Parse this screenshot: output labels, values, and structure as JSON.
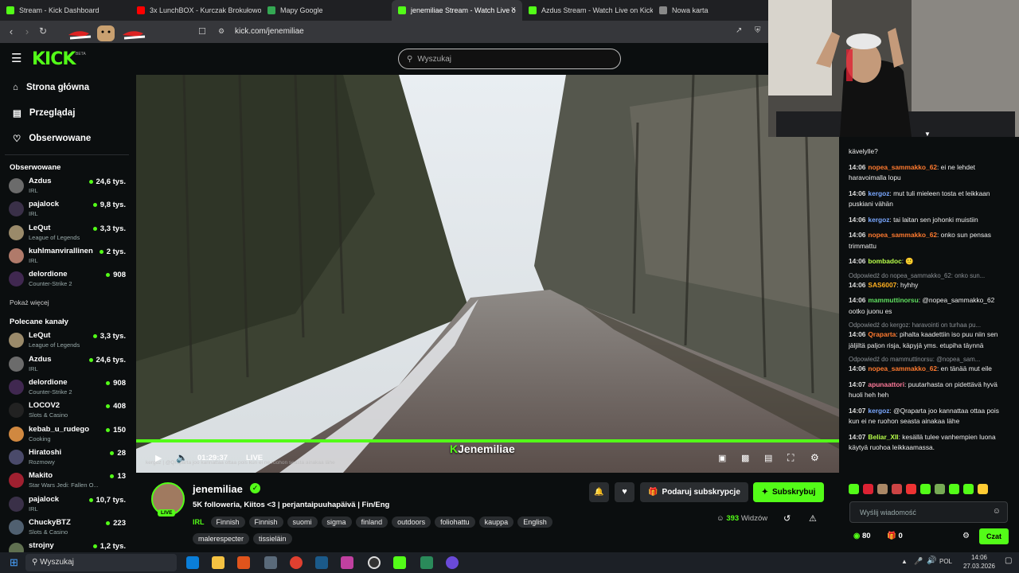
{
  "tabs": [
    {
      "title": "Stream - Kick Dashboard",
      "color": "#53fc18"
    },
    {
      "title": "3x LunchBOX - Kurczak Brokułowo S",
      "color": "#ff0000"
    },
    {
      "title": "Mapy Google",
      "color": "#34a853"
    },
    {
      "title": "jenemiliae Stream - Watch Live o",
      "color": "#53fc18"
    },
    {
      "title": "Azdus Stream - Watch Live on Kick",
      "color": "#53fc18"
    },
    {
      "title": "Nowa karta",
      "color": "#888888"
    }
  ],
  "address": {
    "url": "kick.com/jenemiliae"
  },
  "header": {
    "logo": "KICK",
    "beta": "BETA",
    "search_placeholder": "Wyszukaj"
  },
  "sidebar": {
    "nav": [
      {
        "label": "Strona główna",
        "icon": "home-icon"
      },
      {
        "label": "Przeglądaj",
        "icon": "browse-icon"
      },
      {
        "label": "Obserwowane",
        "icon": "heart-icon"
      }
    ],
    "followed_title": "Obserwowane",
    "followed": [
      {
        "name": "Azdus",
        "cat": "IRL",
        "viewers": "24,6 tys.",
        "color": "#6b6b6b"
      },
      {
        "name": "pajalock",
        "cat": "IRL",
        "viewers": "9,8 tys.",
        "color": "#3a3048"
      },
      {
        "name": "LeQut",
        "cat": "League of Legends",
        "viewers": "3,3 tys.",
        "color": "#9a8a6a"
      },
      {
        "name": "kuhlmanvirallinen",
        "cat": "IRL",
        "viewers": "2 tys.",
        "color": "#b07a6a"
      },
      {
        "name": "delordione",
        "cat": "Counter-Strike 2",
        "viewers": "908",
        "color": "#402850"
      }
    ],
    "show_more": "Pokaż więcej",
    "recommended_title": "Polecane kanały",
    "recommended": [
      {
        "name": "LeQut",
        "cat": "League of Legends",
        "viewers": "3,3 tys.",
        "color": "#9a8a6a"
      },
      {
        "name": "Azdus",
        "cat": "IRL",
        "viewers": "24,6 tys.",
        "color": "#6b6b6b"
      },
      {
        "name": "delordione",
        "cat": "Counter-Strike 2",
        "viewers": "908",
        "color": "#402850"
      },
      {
        "name": "LOCOV2",
        "cat": "Slots & Casino",
        "viewers": "408",
        "color": "#222"
      },
      {
        "name": "kebab_u_rudego",
        "cat": "Cooking",
        "viewers": "150",
        "color": "#d08840"
      },
      {
        "name": "Hiratoshi",
        "cat": "Rozmowy",
        "viewers": "28",
        "color": "#4a4a6a"
      },
      {
        "name": "Makito",
        "cat": "Star Wars Jedi: Fallen O...",
        "viewers": "13",
        "color": "#a02030"
      },
      {
        "name": "pajalock",
        "cat": "IRL",
        "viewers": "10,7 tys.",
        "color": "#3a3048"
      },
      {
        "name": "ChuckyBTZ",
        "cat": "Slots & Casino",
        "viewers": "223",
        "color": "#506070"
      },
      {
        "name": "strojny",
        "cat": "",
        "viewers": "1,2 tys.",
        "color": "#607050"
      }
    ]
  },
  "player": {
    "time": "01:29:37",
    "live": "LIVE",
    "watermark": "Jenemiliae",
    "overlay_chat": "kergoz | @Qraparta joo kannattaa ottaa pois kun ei ne ruohon seasta ainakaa lähe"
  },
  "streamer": {
    "name": "jenemiliae",
    "live_badge": "LIVE",
    "title": "5K followeria, Kiitos <3 | perjantaipuuhapäivä | Fin/Eng",
    "category": "IRL",
    "tags": [
      "Finnish",
      "Finnish",
      "suomi",
      "sigma",
      "finland",
      "outdoors",
      "foliohattu",
      "kauppa",
      "English",
      "malerespecter",
      "tissieläin"
    ],
    "gift_label": "Podaruj subskrypcje",
    "sub_label": "Subskrybuj",
    "viewers": "393",
    "viewers_label": "Widzów"
  },
  "chat": {
    "top_fragment": "kävelylle?",
    "messages": [
      {
        "ts": "14:06",
        "user": "nopea_sammakko_62",
        "color": "#ff7a2f",
        "text": "ei ne lehdet haravoimalla lopu"
      },
      {
        "ts": "14:06",
        "user": "kergoz",
        "color": "#7aa8ff",
        "text": "mut tuli mieleen tosta et leikkaan puskiani vähän"
      },
      {
        "ts": "14:06",
        "user": "kergoz",
        "color": "#7aa8ff",
        "text": "tai laitan sen johonki muistiin"
      },
      {
        "ts": "14:06",
        "user": "nopea_sammakko_62",
        "color": "#ff7a2f",
        "text": "onko sun pensas trimmattu"
      },
      {
        "ts": "14:06",
        "user": "bombadoc",
        "color": "#b8ff4a",
        "text": "🙂"
      },
      {
        "reply": "Odpowiedź do nopea_sammakko_62: onko sun..."
      },
      {
        "ts": "14:06",
        "user": "SAS6007",
        "color": "#ffb020",
        "text": "hyhhy"
      },
      {
        "ts": "14:06",
        "user": "mammuttinorsu",
        "color": "#60e060",
        "text": "@nopea_sammakko_62 ootko juonu es"
      },
      {
        "reply": "Odpowiedź do kergoz: haravointi on turhaa pu..."
      },
      {
        "ts": "14:06",
        "user": "Qraparta",
        "color": "#ff7a2f",
        "text": "pihalta kaadettiin iso puu niin sen jäljiltä paljon risja, käpyjä yms. etupiha täynnä"
      },
      {
        "reply": "Odpowiedź do mammuttinorsu: @nopea_sam..."
      },
      {
        "ts": "14:06",
        "user": "nopea_sammakko_62",
        "color": "#ff7a2f",
        "text": "en tänää mut eile"
      },
      {
        "ts": "14:07",
        "user": "apunaattori",
        "color": "#ff7a9a",
        "text": "puutarhasta on pidettävä hyvä huoli heh heh"
      },
      {
        "ts": "14:07",
        "user": "kergoz",
        "color": "#7aa8ff",
        "text": "@Qraparta joo kannattaa ottaa pois kun ei ne ruohon seasta ainakaa lähe"
      },
      {
        "ts": "14:07",
        "user": "Beliar_XII",
        "color": "#b8ff4a",
        "text": "kesällä tulee vanhempien luona käytyä ruohoa leikkaamassa."
      }
    ],
    "input_placeholder": "Wyślij wiadomość",
    "points": "80",
    "gifts": "0",
    "send_label": "Czat"
  },
  "taskbar": {
    "search_label": "Wyszukaj",
    "lang": "POL",
    "time": "14:06",
    "date": "27.03.2026"
  }
}
